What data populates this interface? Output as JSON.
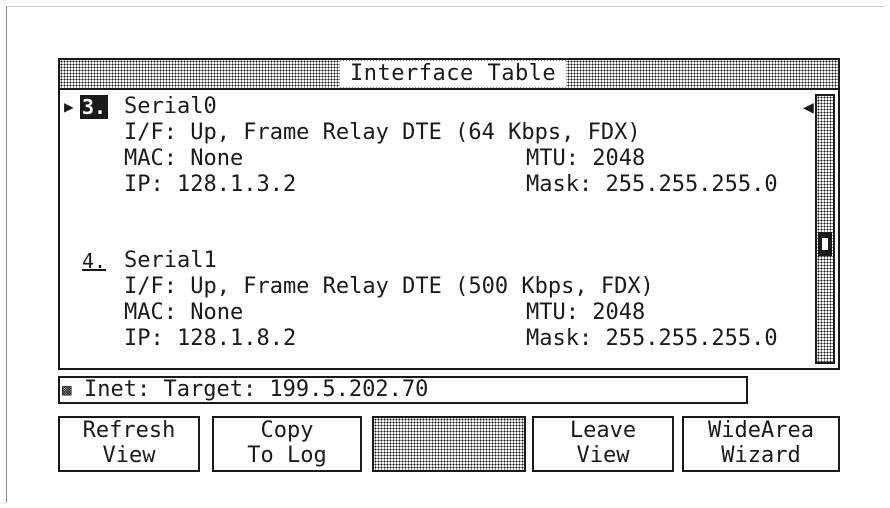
{
  "window": {
    "title": "Interface Table"
  },
  "interfaces": [
    {
      "number": "3.",
      "name": "Serial0",
      "interface_line": "I/F: Up, Frame Relay DTE (64 Kbps, FDX)",
      "mac": "MAC: None",
      "mtu": "MTU: 2048",
      "ip": "IP: 128.1.3.2",
      "mask": "Mask: 255.255.255.0",
      "selected": true
    },
    {
      "number": "4.",
      "name": "Serial1",
      "interface_line": "I/F: Up, Frame Relay DTE (500 Kbps, FDX)",
      "mac": "MAC: None",
      "mtu": "MTU: 2048",
      "ip": "IP: 128.1.8.2",
      "mask": "Mask: 255.255.255.0",
      "selected": false
    }
  ],
  "status_bar": {
    "text": "Inet: Target: 199.5.202.70",
    "icon": "network-icon"
  },
  "function_keys": [
    {
      "line1": "Refresh",
      "line2": "View"
    },
    {
      "line1": "Copy",
      "line2": "To Log"
    },
    {
      "line1": "",
      "line2": ""
    },
    {
      "line1": "Leave",
      "line2": "View"
    },
    {
      "line1": "WideArea",
      "line2": "Wizard"
    }
  ],
  "icons": {
    "selection_marker": "pointer-right-icon",
    "scroll_indicator": "scroll-left-arrow-icon"
  }
}
